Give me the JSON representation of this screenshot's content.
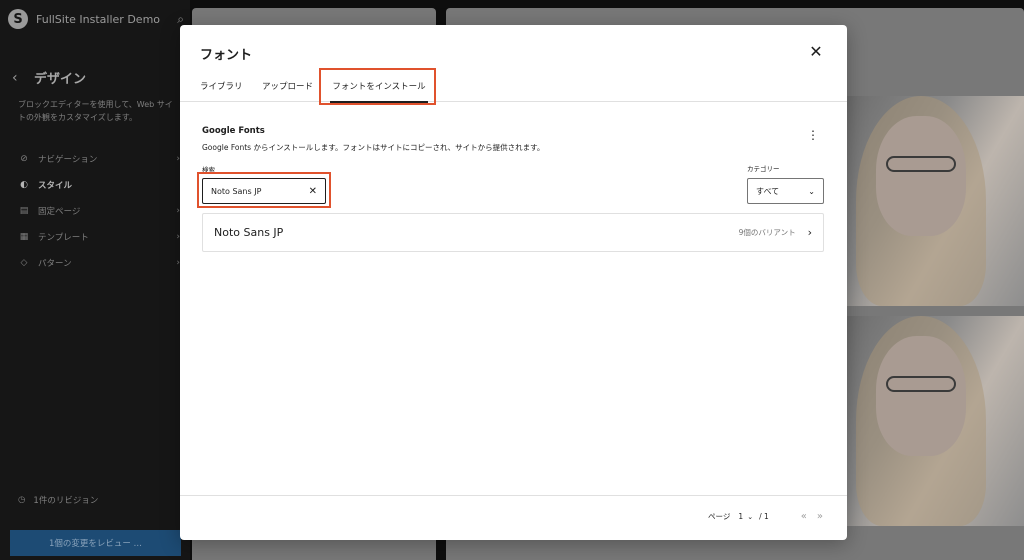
{
  "sidebar": {
    "site_name": "FullSite Installer Demo",
    "section_title": "デザイン",
    "description": "ブロックエディターを使用して、Web サイトの外観をカスタマイズします。",
    "items": [
      {
        "label": "ナビゲーション",
        "icon": "navigation-icon"
      },
      {
        "label": "スタイル",
        "icon": "styles-icon"
      },
      {
        "label": "固定ページ",
        "icon": "page-icon"
      },
      {
        "label": "テンプレート",
        "icon": "template-icon"
      },
      {
        "label": "パターン",
        "icon": "pattern-icon"
      }
    ],
    "revisions": "1件のリビジョン",
    "review_button": "1個の変更をレビュー …"
  },
  "modal": {
    "title": "フォント",
    "tabs": [
      "ライブラリ",
      "アップロード",
      "フォントをインストール"
    ],
    "active_tab": "フォントをインストール",
    "section_title": "Google Fonts",
    "section_desc": "Google Fonts からインストールします。フォントはサイトにコピーされ、サイトから提供されます。",
    "search_label": "検索",
    "search_value": "Noto Sans JP",
    "category_label": "カテゴリー",
    "category_value": "すべて",
    "results": [
      {
        "name": "Noto Sans JP",
        "variants": "9個のバリアント"
      }
    ],
    "pagination": {
      "label": "ページ",
      "current": "1",
      "total": "/ 1"
    }
  },
  "colors": {
    "highlight": "#e0522d",
    "review_button": "#1d4b74"
  }
}
